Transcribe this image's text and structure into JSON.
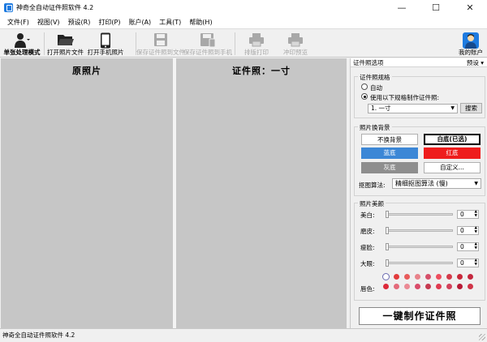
{
  "window": {
    "title": "神奇全自动证件照软件 4.2"
  },
  "menu": [
    "文件(F)",
    "视图(V)",
    "预设(R)",
    "打印(P)",
    "账户(A)",
    "工具(T)",
    "帮助(H)"
  ],
  "toolbar": {
    "single_mode": "单张处理模式",
    "open_photo_file": "打开照片文件",
    "open_phone_photo": "打开手机照片",
    "save_to_file": "保存证件照到文件",
    "save_to_phone": "保存证件照到手机",
    "layout_print": "排版打印",
    "print_preview": "冲印预览",
    "my_account": "我的账户"
  },
  "panes": {
    "original_title": "原照片",
    "id_title": "证件照：一寸"
  },
  "options": {
    "header": "证件照选项",
    "preset": "预设",
    "spec_group": "证件照规格",
    "auto": "自动",
    "use_spec": "使用以下规格制作证件照:",
    "spec_value": "1. 一寸",
    "search": "搜索",
    "bg_group": "照片换背景",
    "bg_none": "不换背景",
    "bg_white": "白底(已选)",
    "bg_blue": "蓝底",
    "bg_red": "红底",
    "bg_gray": "灰底",
    "bg_custom": "自定义...",
    "algo_label": "抠图算法:",
    "algo_value": "精细抠图算法 (慢)",
    "beauty_group": "照片美颜",
    "whitening": "美白:",
    "smoothing": "磨皮:",
    "slim_face": "瘦脸:",
    "big_eyes": "大眼:",
    "whitening_val": "0",
    "smoothing_val": "0",
    "slim_face_val": "0",
    "big_eyes_val": "0",
    "lip_color": "唇色:",
    "make_button": "一键制作证件照"
  },
  "colors": {
    "blue_bg": "#3c87d6",
    "red_bg": "#ee1c1c",
    "gray_bg": "#8e8e8e",
    "lips_row1": [
      "#e23b3b",
      "#e85b5b",
      "#e8828a",
      "#d6506a",
      "#ee4e5e",
      "#d43a4a",
      "#c8283a",
      "#c4283e"
    ],
    "lips_row2": [
      "#dd2a3a",
      "#e46a7a",
      "#eb8a94",
      "#d94c6a",
      "#c63a50",
      "#e03a50",
      "#d2405a",
      "#b81a36",
      "#d03448"
    ]
  },
  "status": {
    "text": "神奇全自动证件照软件 4.2"
  }
}
